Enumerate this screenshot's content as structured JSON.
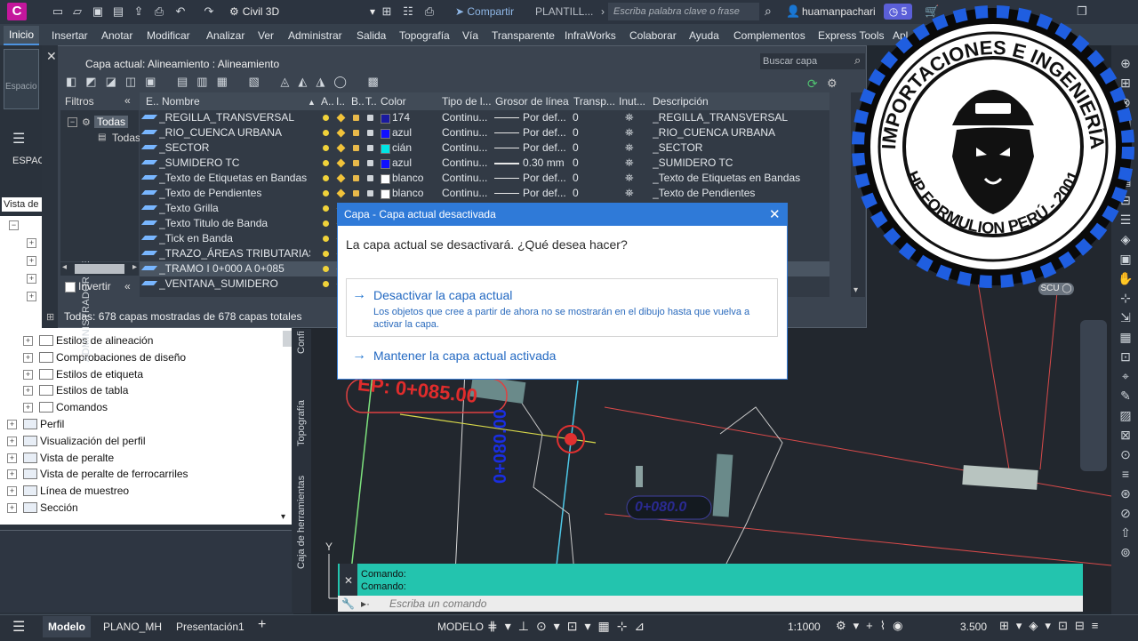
{
  "titlebar": {
    "app_letter": "C",
    "workspace": "Civil 3D",
    "share": "Compartir",
    "template": "PLANTILL...",
    "search_placeholder": "Escriba palabra clave o frase",
    "user": "huamanpachari",
    "notifications": "5"
  },
  "menu": [
    "Inicio",
    "Insertar",
    "Anotar",
    "Modificar",
    "Analizar",
    "Ver",
    "Administrar",
    "Salida",
    "Topografía",
    "Vía",
    "Transparente",
    "InfraWorks",
    "Colaborar",
    "Ayuda",
    "Complementos",
    "Express Tools",
    "Apl"
  ],
  "layer_manager": {
    "side_title": "ADMINISTRADOR DE PROPIEDADES DE CAPAS",
    "current_layer": "Capa actual: Alineamiento : Alineamiento",
    "search_placeholder": "Buscar capa",
    "filters_header": "Filtros",
    "filter_all": "Todas",
    "filter_all_child": "Todas",
    "invert": "Invertir",
    "status": "Todas: 678 capas mostradas de 678 capas totales",
    "columns": [
      "E..",
      "Nombre",
      "A..",
      "I..",
      "B..",
      "T..",
      "Color",
      "Tipo de l...",
      "Grosor de línea",
      "Transp...",
      "Inut...",
      "Descripción"
    ],
    "rows": [
      {
        "name": "_REGILLA_TRANSVERSAL",
        "color": "174",
        "swatch": "#1a1aa0",
        "linetype": "Continu...",
        "lineweight": "Por def...",
        "transparency": "0",
        "description": "_REGILLA_TRANSVERSAL",
        "thick": false
      },
      {
        "name": "_RIO_CUENCA URBANA",
        "color": "azul",
        "swatch": "#1010ff",
        "linetype": "Continu...",
        "lineweight": "Por def...",
        "transparency": "0",
        "description": "_RIO_CUENCA URBANA",
        "thick": false
      },
      {
        "name": "_SECTOR",
        "color": "cián",
        "swatch": "#00e5e5",
        "linetype": "Continu...",
        "lineweight": "Por def...",
        "transparency": "0",
        "description": "_SECTOR",
        "thick": false
      },
      {
        "name": "_SUMIDERO TC",
        "color": "azul",
        "swatch": "#1010ff",
        "linetype": "Continu...",
        "lineweight": "0.30 mm",
        "transparency": "0",
        "description": "_SUMIDERO TC",
        "thick": true
      },
      {
        "name": "_Texto de Etiquetas en Bandas",
        "color": "blanco",
        "swatch": "#ffffff",
        "linetype": "Continu...",
        "lineweight": "Por def...",
        "transparency": "0",
        "description": "_Texto de Etiquetas en Bandas",
        "thick": false
      },
      {
        "name": "_Texto de Pendientes",
        "color": "blanco",
        "swatch": "#ffffff",
        "linetype": "Continu...",
        "lineweight": "Por def...",
        "transparency": "0",
        "description": "_Texto de Pendientes",
        "thick": false
      },
      {
        "name": "_Texto Grilla"
      },
      {
        "name": "_Texto Titulo de Banda"
      },
      {
        "name": "_Tick en Banda"
      },
      {
        "name": "_TRAZO_ÁREAS TRIBUTARIAS"
      },
      {
        "name": "_TRAMO I 0+000 A 0+085"
      },
      {
        "name": "_VENTANA_SUMIDERO"
      }
    ]
  },
  "tree": {
    "view_label": "Vista de c",
    "items": [
      {
        "label": "Estilos de alineación",
        "indent": 2
      },
      {
        "label": "Comprobaciones de diseño",
        "indent": 2
      },
      {
        "label": "Estilos de etiqueta",
        "indent": 2
      },
      {
        "label": "Estilos de tabla",
        "indent": 2
      },
      {
        "label": "Comandos",
        "indent": 2
      },
      {
        "label": "Perfil",
        "indent": 1
      },
      {
        "label": "Visualización del perfil",
        "indent": 1
      },
      {
        "label": "Vista de peralte",
        "indent": 1
      },
      {
        "label": "Vista de peralte de ferrocarriles",
        "indent": 1
      },
      {
        "label": "Línea de muestreo",
        "indent": 1
      },
      {
        "label": "Sección",
        "indent": 1
      }
    ],
    "side_tabs": [
      "Topografía",
      "Caja de herramientas",
      "Confi"
    ]
  },
  "left_panel": {
    "espacio": "ESPAC",
    "espacio2": "Espacio"
  },
  "dialog": {
    "title": "Capa - Capa actual desactivada",
    "question": "La capa actual se desactivará. ¿Qué desea hacer?",
    "option1_title": "Desactivar la capa actual",
    "option1_desc": "Los objetos que cree a partir de ahora no se mostrarán en el dibujo hasta que vuelva a activar la capa.",
    "option2_title": "Mantener la capa actual activada"
  },
  "drawing": {
    "ep_label": "EP: 0+085.00",
    "station1": "0+080.00",
    "station2": "0+080.0"
  },
  "command": {
    "line1": "Comando:",
    "line2": "Comando:",
    "placeholder": "Escriba un comando"
  },
  "statusbar": {
    "tabs": [
      "Modelo",
      "PLANO_MH",
      "Presentación1"
    ],
    "space": "MODELO",
    "scale": "1:1000",
    "value": "3.500"
  },
  "logo": {
    "top_text": "IMPORTACIONES E INGENIERÍA",
    "bottom_text": "HP FORMULION PERÚ - 2001"
  }
}
